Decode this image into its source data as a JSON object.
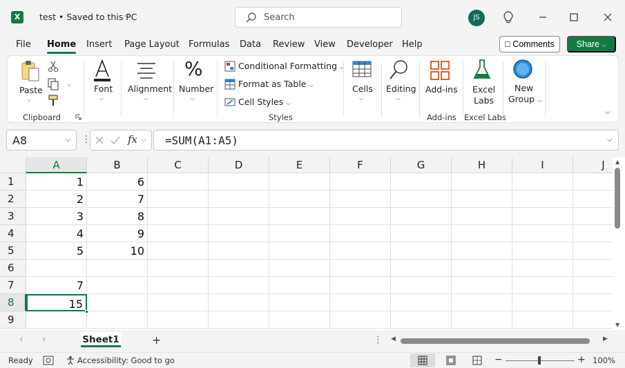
{
  "titlebar": {
    "doc_title": "test • Saved to this PC",
    "search_placeholder": "Search",
    "user_initials": "JS"
  },
  "menu": {
    "tabs": [
      "File",
      "Home",
      "Insert",
      "Page Layout",
      "Formulas",
      "Data",
      "Review",
      "View",
      "Developer",
      "Help"
    ],
    "active": "Home",
    "comments_label": "Comments",
    "share_label": "Share"
  },
  "ribbon": {
    "clipboard": {
      "paste": "Paste",
      "label": "Clipboard"
    },
    "font": {
      "label": "Font"
    },
    "alignment": {
      "label": "Alignment"
    },
    "number": {
      "label": "Number"
    },
    "styles": {
      "conditional": "Conditional Formatting",
      "format_table": "Format as Table",
      "cell_styles": "Cell Styles",
      "label": "Styles"
    },
    "cells": {
      "label": "Cells"
    },
    "editing": {
      "label": "Editing"
    },
    "addins": {
      "button": "Add-ins",
      "label": "Add-ins"
    },
    "excel_labs": {
      "line1": "Excel",
      "line2": "Labs",
      "label": "Excel Labs"
    },
    "new_group": {
      "line1": "New",
      "line2": "Group"
    }
  },
  "formula_bar": {
    "name_box": "A8",
    "formula": "=SUM(A1:A5)"
  },
  "grid": {
    "columns": [
      "A",
      "B",
      "C",
      "D",
      "E",
      "F",
      "G",
      "H",
      "I",
      "J"
    ],
    "rows": [
      "1",
      "2",
      "3",
      "4",
      "5",
      "6",
      "7",
      "8",
      "9"
    ],
    "cells": {
      "A1": "1",
      "B1": "6",
      "A2": "2",
      "B2": "7",
      "A3": "3",
      "B3": "8",
      "A4": "4",
      "B4": "9",
      "A5": "5",
      "B5": "10",
      "A7": "7",
      "A8": "15"
    },
    "active_cell": "A8"
  },
  "sheets": {
    "tabs": [
      "Sheet1"
    ]
  },
  "status": {
    "ready": "Ready",
    "accessibility": "Accessibility: Good to go",
    "zoom": "100%"
  },
  "colors": {
    "accent": "#107c41"
  }
}
